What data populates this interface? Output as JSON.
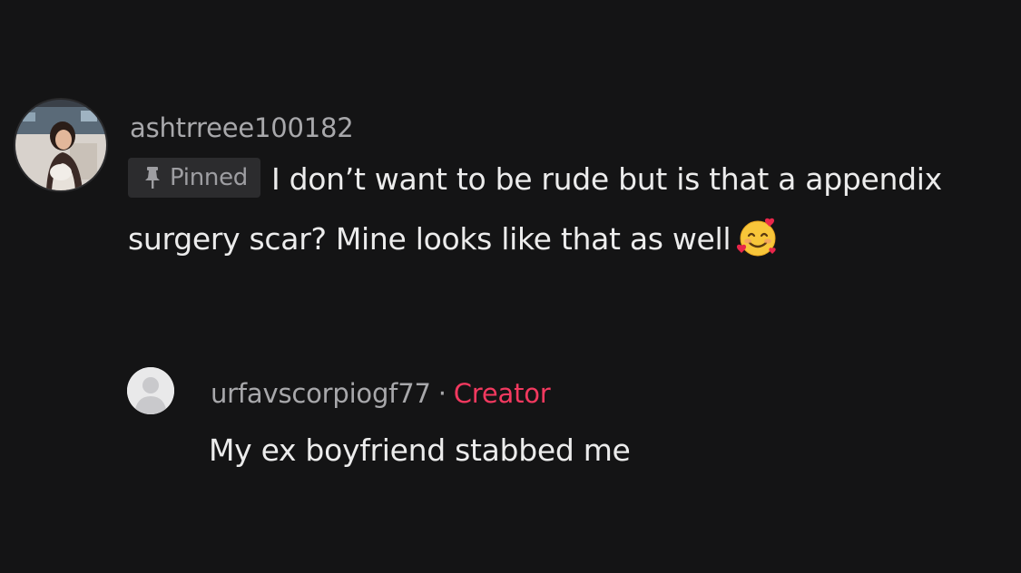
{
  "comment": {
    "username": "ashtrreee100182",
    "pinned_label": "Pinned",
    "text": "I don’t want to be rude but is that a appendix surgery scar? Mine looks like that as well",
    "emoji": "smiling-face-with-hearts"
  },
  "reply": {
    "username": "urfavscorpiogf77",
    "separator": "·",
    "badge": "Creator",
    "text": "My ex boyfriend stabbed me"
  },
  "colors": {
    "background": "#141415",
    "text_primary": "#ececec",
    "text_secondary": "#a8a8ab",
    "creator_accent": "#f2395f",
    "pinned_bg": "#2c2c2e"
  },
  "icons": {
    "pin": "pin-icon",
    "default_avatar": "default-avatar-icon"
  }
}
